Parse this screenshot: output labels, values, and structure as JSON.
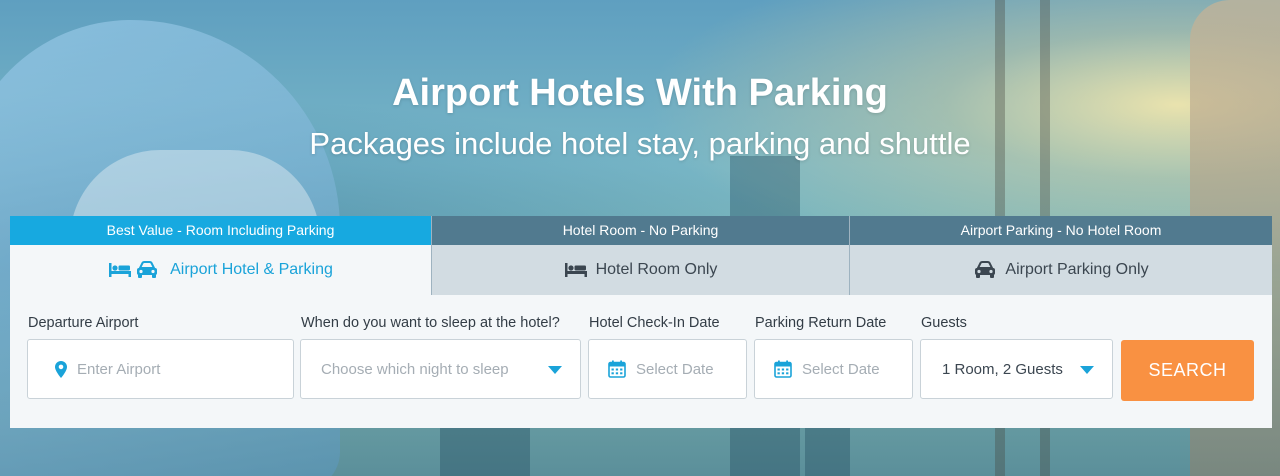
{
  "hero": {
    "title": "Airport Hotels With Parking",
    "subtitle": "Packages include hotel stay, parking and shuttle"
  },
  "tabs": [
    {
      "header": "Best Value - Room Including Parking",
      "label": "Airport Hotel & Parking",
      "icons": [
        "bed-icon",
        "car-icon"
      ],
      "active": true
    },
    {
      "header": "Hotel Room - No Parking",
      "label": "Hotel Room Only",
      "icons": [
        "bed-icon"
      ],
      "active": false
    },
    {
      "header": "Airport Parking - No Hotel Room",
      "label": "Airport Parking Only",
      "icons": [
        "car-icon"
      ],
      "active": false
    }
  ],
  "form": {
    "departure": {
      "label": "Departure Airport",
      "placeholder": "Enter Airport",
      "icon": "map-pin-icon"
    },
    "sleep_night": {
      "label": "When do you want to sleep at the hotel?",
      "placeholder": "Choose which night to sleep"
    },
    "checkin": {
      "label": "Hotel Check-In Date",
      "placeholder": "Select Date",
      "icon": "calendar-icon"
    },
    "parking_return": {
      "label": "Parking Return Date",
      "placeholder": "Select Date",
      "icon": "calendar-icon"
    },
    "guests": {
      "label": "Guests",
      "value": "1 Room, 2 Guests"
    },
    "search_label": "SEARCH"
  },
  "colors": {
    "accent_blue": "#17a9e0",
    "tab_inactive": "#517a8f",
    "search_orange": "#f99142"
  }
}
